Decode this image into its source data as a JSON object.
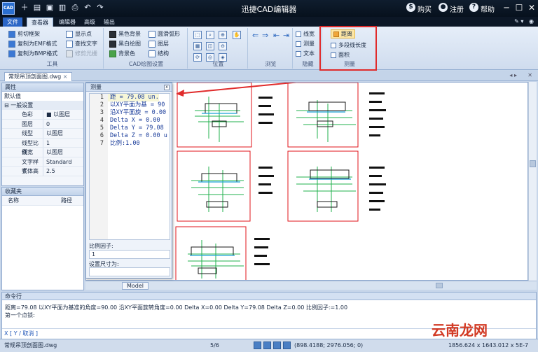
{
  "app": {
    "title": "迅捷CAD编辑器",
    "logo_text": "CAD",
    "title_links": {
      "buy": "购买",
      "register": "注册",
      "help": "帮助"
    }
  },
  "ribbon": {
    "tabs": [
      "文件",
      "查看器",
      "编辑器",
      "高级",
      "输出"
    ],
    "active_tab": "查看器",
    "groups": {
      "tools": {
        "label": "工具",
        "items": [
          "剪切框架",
          "复制为EMF格式",
          "复制为BMP格式",
          "显示点",
          "查找文字",
          "修剪光栅"
        ]
      },
      "cad_settings": {
        "label": "CAD绘图设置",
        "items": [
          "黑色背景",
          "黑白绘图",
          "背景色",
          "圆滑弧形",
          "图层",
          "结构"
        ]
      },
      "position": {
        "label": "位置"
      },
      "browse": {
        "label": "浏览"
      },
      "hide": {
        "label": "隐藏",
        "items": [
          "线宽",
          "测量",
          "文本"
        ]
      },
      "measure": {
        "label": "测量",
        "items": [
          "距离",
          "多段线长度",
          "面积"
        ]
      }
    }
  },
  "document": {
    "tab": "常规吊顶剖面图.dwg"
  },
  "properties_panel": {
    "title": "属性",
    "default_value": "默认值",
    "category": "一般设置",
    "rows": [
      {
        "key": "色彩",
        "value": "■ 以图层"
      },
      {
        "key": "图层",
        "value": "0"
      },
      {
        "key": "线型",
        "value": "以图层"
      },
      {
        "key": "线型比例",
        "value": "1"
      },
      {
        "key": "线宽",
        "value": "以图层"
      },
      {
        "key": "文字样式",
        "value": "Standard"
      },
      {
        "key": "字体高",
        "value": "2.5"
      }
    ]
  },
  "favorites_panel": {
    "title": "收藏夹",
    "columns": [
      "名称",
      "路径"
    ]
  },
  "measure_popup": {
    "title": "测量",
    "lines": [
      {
        "n": "1",
        "t": "距 = 79.08 un."
      },
      {
        "n": "2",
        "t": "以XY平面为基 = 90"
      },
      {
        "n": "3",
        "t": "沿XY平面旋 = 0.00"
      },
      {
        "n": "4",
        "t": "Delta X = 0.00"
      },
      {
        "n": "5",
        "t": "Delta Y = 79.08"
      },
      {
        "n": "6",
        "t": "Delta Z = 0.00 u"
      },
      {
        "n": "7",
        "t": "比例:1.00"
      }
    ],
    "scale_label": "比例因子:",
    "scale_value": "1",
    "set_size_label": "设置尺寸为:",
    "set_size_value": ""
  },
  "canvas": {
    "model_tab": "Model"
  },
  "command": {
    "title": "命令行",
    "output": "距离=79.08  以XY平面为基准的角度=90.00  沿XY平面旋转角度=0.00  Delta X=0.00  Delta Y=79.08  Delta Z=0.00  比例因子:=1.00",
    "prompt_line": "第一个点锁:",
    "options": "X [ Y / 取消 ]"
  },
  "status": {
    "file": "常规吊顶剖面图.dwg",
    "page": "5/6",
    "coords": "(898.4188; 2976.056; 0)",
    "size": "1856.624 x 1643.012 x 5E-7"
  },
  "watermark": "云南龙网",
  "colors": {
    "measure_highlight": "#e02b2b",
    "cad_red": "#e0161b",
    "cad_green": "#22b14c"
  }
}
